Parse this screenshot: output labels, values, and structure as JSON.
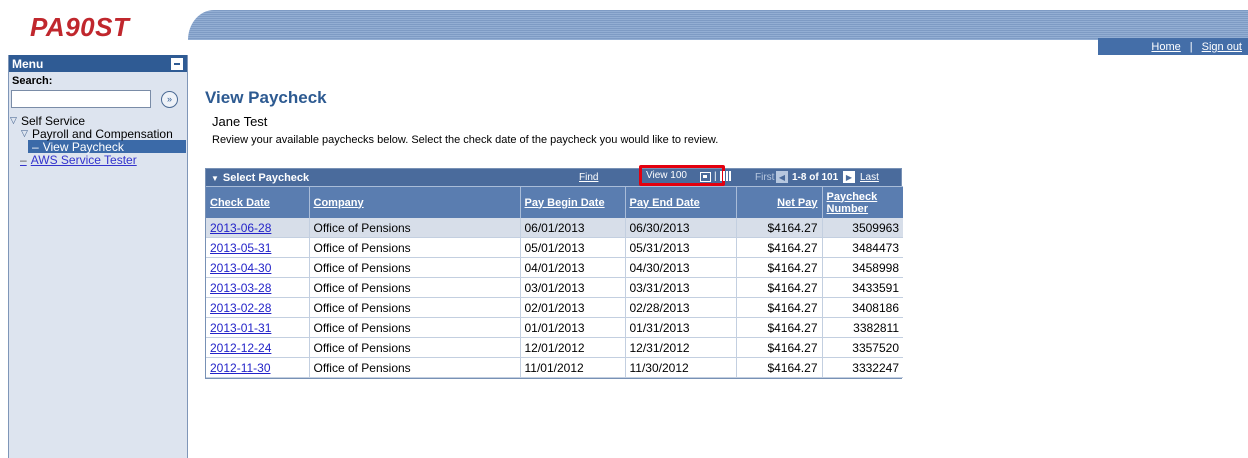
{
  "app": {
    "logo_text": "PA90ST"
  },
  "header": {
    "home_label": "Home",
    "separator": "|",
    "signout_label": "Sign out"
  },
  "sidebar": {
    "menu_label": "Menu",
    "search_label": "Search:",
    "search_value": "",
    "go_glyph": "»",
    "tree": {
      "self_service": "Self Service",
      "payroll": "Payroll and Compensation",
      "view_paycheck": "View Paycheck",
      "aws_tester": "AWS Service Tester"
    }
  },
  "page": {
    "title": "View Paycheck",
    "person": "Jane Test",
    "instructions": "Review your available paychecks below. Select the check date of the paycheck you would like to review."
  },
  "grid": {
    "caption": "Select Paycheck",
    "find_label": "Find",
    "view_label": "View 100",
    "first_label": "First",
    "count_label": "1-8 of 101",
    "last_label": "Last",
    "columns": [
      "Check Date",
      "Company",
      "Pay Begin Date",
      "Pay End Date",
      "Net Pay",
      "Paycheck Number"
    ],
    "rows": [
      [
        "2013-06-28",
        "Office of Pensions",
        "06/01/2013",
        "06/30/2013",
        "$4164.27",
        "3509963"
      ],
      [
        "2013-05-31",
        "Office of Pensions",
        "05/01/2013",
        "05/31/2013",
        "$4164.27",
        "3484473"
      ],
      [
        "2013-04-30",
        "Office of Pensions",
        "04/01/2013",
        "04/30/2013",
        "$4164.27",
        "3458998"
      ],
      [
        "2013-03-28",
        "Office of Pensions",
        "03/01/2013",
        "03/31/2013",
        "$4164.27",
        "3433591"
      ],
      [
        "2013-02-28",
        "Office of Pensions",
        "02/01/2013",
        "02/28/2013",
        "$4164.27",
        "3408186"
      ],
      [
        "2013-01-31",
        "Office of Pensions",
        "01/01/2013",
        "01/31/2013",
        "$4164.27",
        "3382811"
      ],
      [
        "2012-12-24",
        "Office of Pensions",
        "12/01/2012",
        "12/31/2012",
        "$4164.27",
        "3357520"
      ],
      [
        "2012-11-30",
        "Office of Pensions",
        "11/01/2012",
        "11/30/2012",
        "$4164.27",
        "3332247"
      ]
    ]
  },
  "colors": {
    "title_blue": "#2d5a91",
    "grid_bar": "#4a6b9c",
    "highlight_box": "#e3000f",
    "logo_red": "#c0272d"
  }
}
